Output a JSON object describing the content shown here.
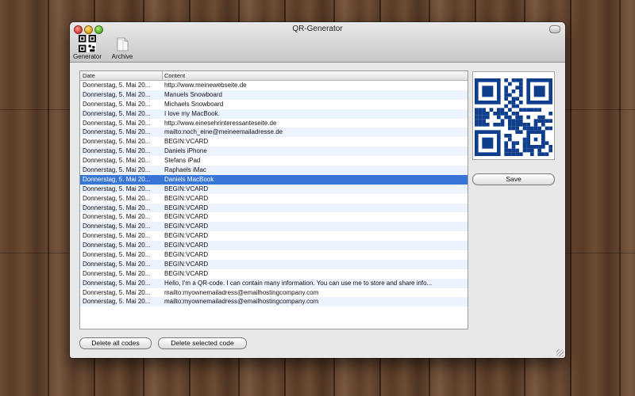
{
  "window": {
    "title": "QR-Generator"
  },
  "toolbar": {
    "generator_label": "Generator",
    "archive_label": "Archive"
  },
  "table": {
    "columns": [
      "Date",
      "Content"
    ],
    "selected_index": 10,
    "rows": [
      {
        "date": "Donnerstag, 5. Mai 20...",
        "content": "http://www.meinewebseite.de"
      },
      {
        "date": "Donnerstag, 5. Mai 20...",
        "content": "Manuels Snowboard"
      },
      {
        "date": "Donnerstag, 5. Mai 20...",
        "content": "Michaels Snowboard"
      },
      {
        "date": "Donnerstag, 5. Mai 20...",
        "content": "I love my MacBook."
      },
      {
        "date": "Donnerstag, 5. Mai 20...",
        "content": "http://www.einesehrinteressanteseite.de"
      },
      {
        "date": "Donnerstag, 5. Mai 20...",
        "content": "mailto:noch_eine@meineemailadresse.de"
      },
      {
        "date": "Donnerstag, 5. Mai 20...",
        "content": "BEGIN:VCARD"
      },
      {
        "date": "Donnerstag, 5. Mai 20...",
        "content": "Daniels iPhone"
      },
      {
        "date": "Donnerstag, 5. Mai 20...",
        "content": "Stefans iPad"
      },
      {
        "date": "Donnerstag, 5. Mai 20...",
        "content": "Raphaels iMac"
      },
      {
        "date": "Donnerstag, 5. Mai 20...",
        "content": "Daniels MacBook"
      },
      {
        "date": "Donnerstag, 5. Mai 20...",
        "content": "BEGIN:VCARD"
      },
      {
        "date": "Donnerstag, 5. Mai 20...",
        "content": "BEGIN:VCARD"
      },
      {
        "date": "Donnerstag, 5. Mai 20...",
        "content": "BEGIN:VCARD"
      },
      {
        "date": "Donnerstag, 5. Mai 20...",
        "content": "BEGIN:VCARD"
      },
      {
        "date": "Donnerstag, 5. Mai 20...",
        "content": "BEGIN:VCARD"
      },
      {
        "date": "Donnerstag, 5. Mai 20...",
        "content": "BEGIN:VCARD"
      },
      {
        "date": "Donnerstag, 5. Mai 20...",
        "content": "BEGIN:VCARD"
      },
      {
        "date": "Donnerstag, 5. Mai 20...",
        "content": "BEGIN:VCARD"
      },
      {
        "date": "Donnerstag, 5. Mai 20...",
        "content": "BEGIN:VCARD"
      },
      {
        "date": "Donnerstag, 5. Mai 20...",
        "content": "BEGIN:VCARD"
      },
      {
        "date": "Donnerstag, 5. Mai 20...",
        "content": "Hello, I'm a QR-code. I can contain many information. You can use me to store and share info..."
      },
      {
        "date": "Donnerstag, 5. Mai 20...",
        "content": "mailto:myownemailadress@emailhostingcompany.com"
      },
      {
        "date": "Donnerstag, 5. Mai 20...",
        "content": "mailto:myownemailadress@emailhostingcompany.com"
      }
    ]
  },
  "preview": {
    "qr_color": "#0f3f8c",
    "icon": "qr-code-icon"
  },
  "buttons": {
    "save_label": "Save",
    "delete_all_label": "Delete all codes",
    "delete_selected_label": "Delete selected code"
  },
  "colors": {
    "selection": "#3875d7",
    "stripe": "#edf3fe"
  }
}
